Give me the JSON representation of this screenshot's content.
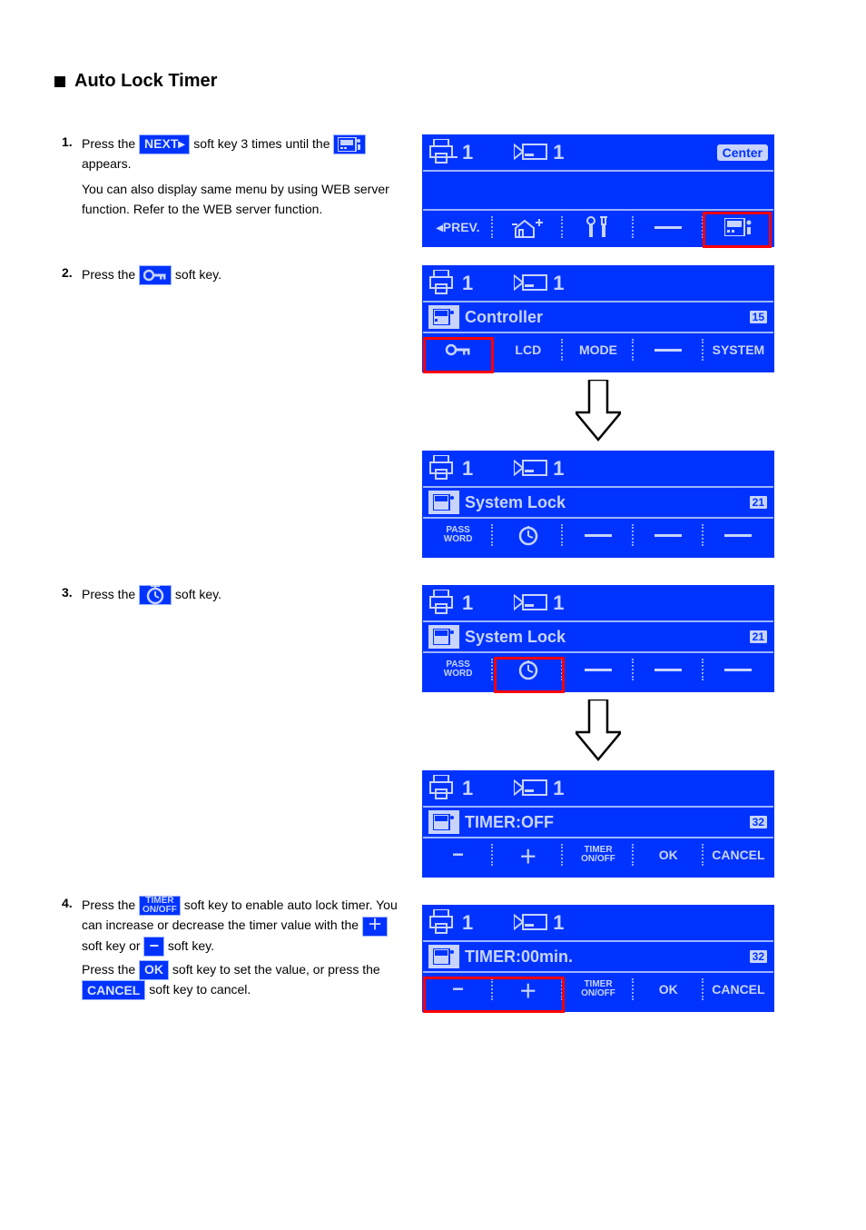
{
  "section_title": "Auto Lock Timer",
  "steps": {
    "s1": {
      "num": "1.",
      "a": "Press the ",
      "b": " soft key 3 times until the ",
      "c": "You can also display same menu by using WEB server function. Refer to the WEB server function."
    },
    "s2": {
      "num": "2.",
      "a": "Press the ",
      "b": " soft key."
    },
    "s3": {
      "num": "3.",
      "a": "Press the ",
      "b": " soft key."
    },
    "s4": {
      "num": "4.",
      "a": "Press the ",
      "b": " soft key to enable auto lock timer. You can increase or decrease the timer value with the ",
      "c": " soft key or ",
      "d": " soft key.",
      "e": "Press the ",
      "f": " soft key to set the value, or press the ",
      "g": " soft key to cancel."
    }
  },
  "labels": {
    "next": "NEXT▸",
    "center": "Center",
    "prev": "◂PREV.",
    "controller": "Controller",
    "lcd": "LCD",
    "mode": "MODE",
    "system": "SYSTEM",
    "system_lock": "System Lock",
    "password": "PASS\nWORD",
    "timer_off": "TIMER:OFF",
    "timer_00": "TIMER:00min.",
    "timer_onoff": "TIMER\nON/OFF",
    "ok": "OK",
    "cancel": "CANCEL",
    "minus": "−",
    "plus": "＋",
    "num15": "15",
    "num21": "21",
    "num32": "32",
    "one": "1"
  }
}
